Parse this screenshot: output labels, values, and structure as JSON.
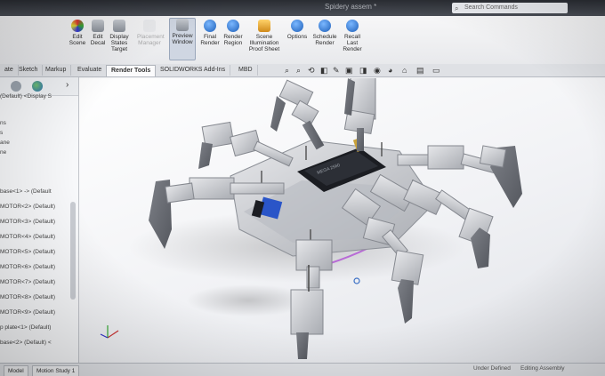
{
  "titlebar": {
    "document": "Spidery assem *",
    "search_placeholder": "Search Commands"
  },
  "ribbon": {
    "buttons": [
      {
        "label": "Edit Scene",
        "icon": "edit-scene-icon"
      },
      {
        "label": "Edit Decal",
        "icon": "edit-decal-icon"
      },
      {
        "label": "Display States Target",
        "icon": "display-states-icon"
      },
      {
        "label": "Placement Manager",
        "icon": "placement-manager-icon"
      },
      {
        "label": "Preview Window",
        "icon": "preview-window-icon"
      },
      {
        "label": "Final Render",
        "icon": "final-render-icon"
      },
      {
        "label": "Render Region",
        "icon": "render-region-icon"
      },
      {
        "label": "Scene Illumination Proof Sheet",
        "icon": "illumination-icon"
      },
      {
        "label": "Options",
        "icon": "options-icon"
      },
      {
        "label": "Schedule Render",
        "icon": "schedule-render-icon"
      },
      {
        "label": "Recall Last Render",
        "icon": "recall-render-icon"
      }
    ]
  },
  "tabs": [
    "ate",
    "Sketch",
    "Markup",
    "Evaluate",
    "Render Tools",
    "SOLIDWORKS Add-Ins",
    "MBD"
  ],
  "active_tab": "Render Tools",
  "tree": {
    "rows": [
      "(Default) <Display S",
      "ns",
      "s",
      "ane",
      "ne",
      "",
      "base<1> -> (Default",
      "MOTOR<2> (Default)",
      "MOTOR<3> (Default)",
      "MOTOR<4> (Default)",
      "MOTOR<5> (Default)",
      "MOTOR<6> (Default)",
      "MOTOR<7> (Default)",
      "MOTOR<8> (Default)",
      "MOTOR<9> (Default)",
      "p plate<1> (Default)",
      "base<2> (Default) <"
    ]
  },
  "status": {
    "tabs": [
      "Model",
      "Motion Study 1"
    ],
    "mode": "Under Defined",
    "editing": "Editing Assembly"
  },
  "colors": {
    "accent": "#1e5fb8",
    "ribbon_bg": "#f2f3f5",
    "part_grey": "#c7c9cd",
    "board_dark": "#1b1d22",
    "motor_blue": "#2a55c8",
    "path_magenta": "#b86bd6"
  }
}
